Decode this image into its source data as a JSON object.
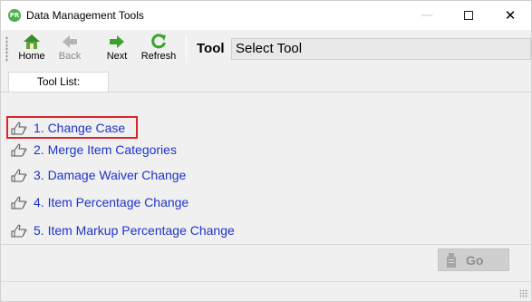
{
  "window": {
    "title": "Data Management Tools",
    "app_icon_text": "PR",
    "minimize_glyph": "—",
    "close_glyph": "✕"
  },
  "toolbar": {
    "home_label": "Home",
    "back_label": "Back",
    "next_label": "Next",
    "refresh_label": "Refresh",
    "tool_label": "Tool",
    "tool_value": "Select Tool"
  },
  "tab": {
    "label": "Tool List:"
  },
  "tools": [
    {
      "label": "1.  Change Case",
      "selected": true
    },
    {
      "label": "2.  Merge Item Categories"
    },
    {
      "label": "3.  Damage Waiver Change"
    },
    {
      "label": "4.  Item Percentage Change"
    },
    {
      "label": "5.  Item Markup Percentage Change"
    }
  ],
  "go_button": {
    "label": "Go",
    "enabled": false
  },
  "colors": {
    "link": "#1e35c8",
    "highlight_border": "#d9252a",
    "app_icon": "#4caf50"
  }
}
